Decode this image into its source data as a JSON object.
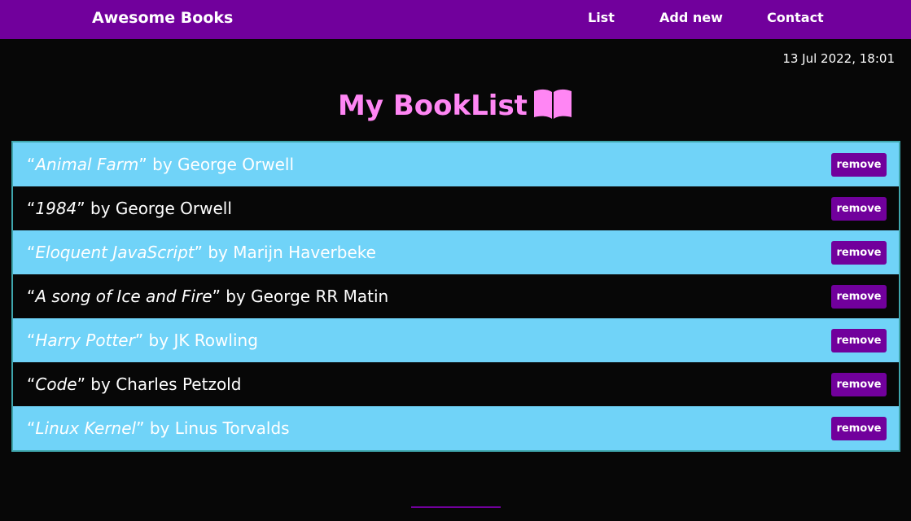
{
  "navbar": {
    "brand": "Awesome Books",
    "links": [
      "List",
      "Add new",
      "Contact"
    ]
  },
  "datetime": "13 Jul 2022, 18:01",
  "page_title": "My BookList",
  "icons": {
    "title_icon": "open-book-icon"
  },
  "colors": {
    "nav_bg": "#71009c",
    "title": "#ff86f4",
    "alt_row": "#70d3f8",
    "background": "#070707"
  },
  "books": [
    {
      "title": "Animal Farm",
      "author": "George Orwell",
      "remove_label": "remove"
    },
    {
      "title": "1984",
      "author": "George Orwell",
      "remove_label": "remove"
    },
    {
      "title": "Eloquent JavaScript",
      "author": "Marijn Haverbeke",
      "remove_label": "remove"
    },
    {
      "title": "A song of Ice and Fire",
      "author": "George RR Matin",
      "remove_label": "remove"
    },
    {
      "title": "Harry Potter",
      "author": "JK Rowling",
      "remove_label": "remove"
    },
    {
      "title": "Code",
      "author": "Charles Petzold",
      "remove_label": "remove"
    },
    {
      "title": "Linux Kernel",
      "author": "Linus Torvalds",
      "remove_label": "remove"
    }
  ]
}
